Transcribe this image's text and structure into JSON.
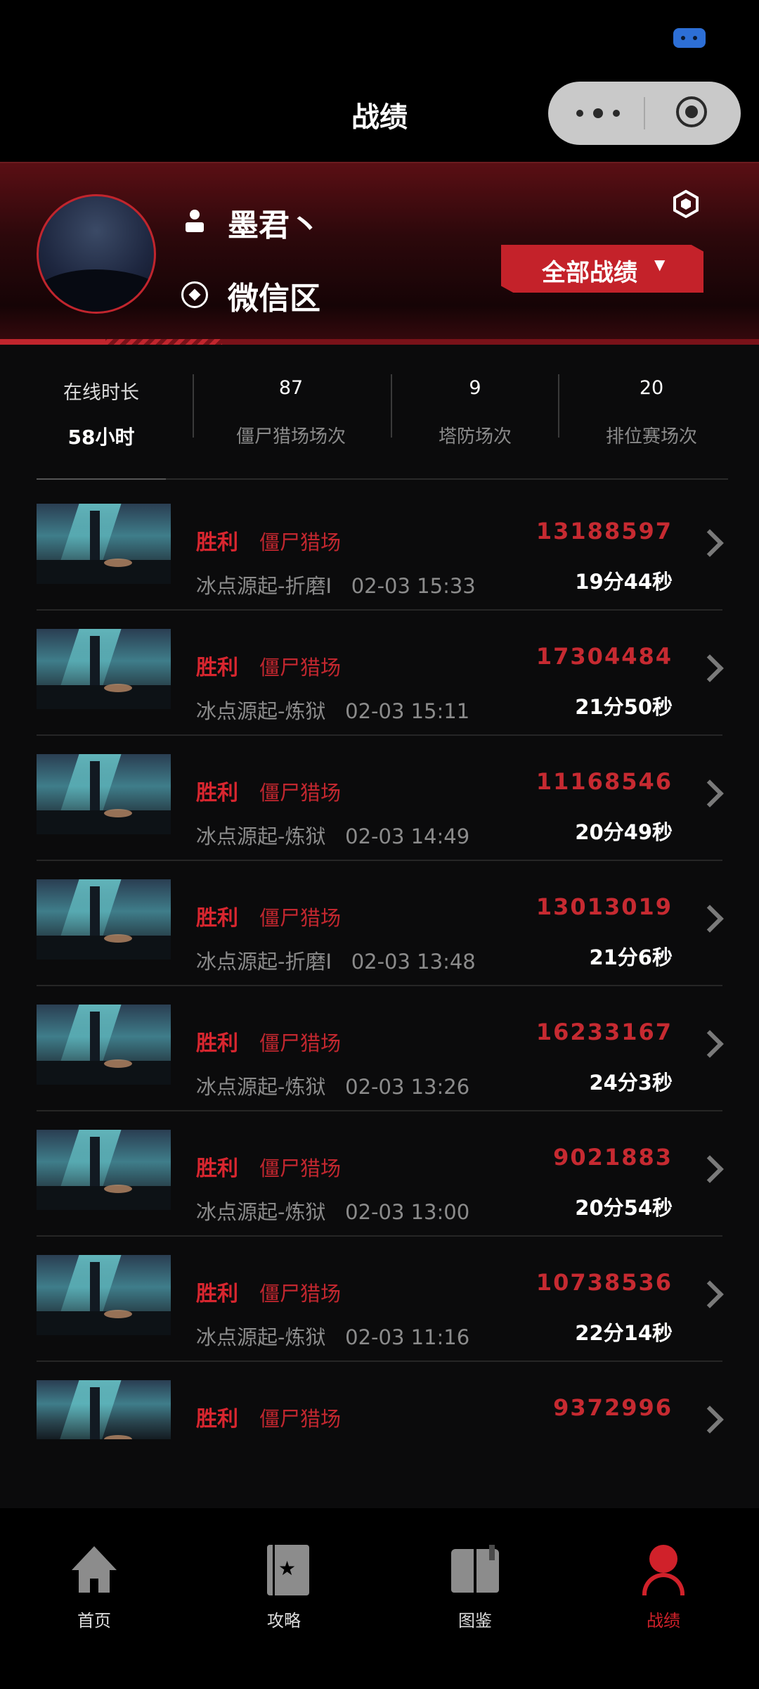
{
  "nav": {
    "title": "战绩"
  },
  "profile": {
    "username": "墨君丶",
    "zone": "微信区",
    "filter_label": "全部战绩",
    "filter_caret": "▼"
  },
  "stats": [
    {
      "top": "在线时长",
      "bottom": "58小时"
    },
    {
      "top": "87",
      "bottom": "僵尸猎场场次"
    },
    {
      "top": "9",
      "bottom": "塔防场次"
    },
    {
      "top": "20",
      "bottom": "排位赛场次"
    }
  ],
  "records": [
    {
      "result": "胜利",
      "mode": "僵尸猎场",
      "map": "冰点源起-折磨I",
      "time": "02-03 15:33",
      "score": "13188597",
      "duration": "19分44秒"
    },
    {
      "result": "胜利",
      "mode": "僵尸猎场",
      "map": "冰点源起-炼狱",
      "time": "02-03 15:11",
      "score": "17304484",
      "duration": "21分50秒"
    },
    {
      "result": "胜利",
      "mode": "僵尸猎场",
      "map": "冰点源起-炼狱",
      "time": "02-03 14:49",
      "score": "11168546",
      "duration": "20分49秒"
    },
    {
      "result": "胜利",
      "mode": "僵尸猎场",
      "map": "冰点源起-折磨I",
      "time": "02-03 13:48",
      "score": "13013019",
      "duration": "21分6秒"
    },
    {
      "result": "胜利",
      "mode": "僵尸猎场",
      "map": "冰点源起-炼狱",
      "time": "02-03 13:26",
      "score": "16233167",
      "duration": "24分3秒"
    },
    {
      "result": "胜利",
      "mode": "僵尸猎场",
      "map": "冰点源起-炼狱",
      "time": "02-03 13:00",
      "score": "9021883",
      "duration": "20分54秒"
    },
    {
      "result": "胜利",
      "mode": "僵尸猎场",
      "map": "冰点源起-炼狱",
      "time": "02-03 11:16",
      "score": "10738536",
      "duration": "22分14秒"
    },
    {
      "result": "胜利",
      "mode": "僵尸猎场",
      "map": "",
      "time": "",
      "score": "9372996",
      "duration": ""
    }
  ],
  "tabs": [
    {
      "label": "首页",
      "icon": "home-icon",
      "active": false
    },
    {
      "label": "攻略",
      "icon": "guide-book-icon",
      "active": false
    },
    {
      "label": "图鉴",
      "icon": "atlas-book-icon",
      "active": false
    },
    {
      "label": "战绩",
      "icon": "person-icon",
      "active": true
    }
  ],
  "colors": {
    "accent": "#c4222a",
    "background": "#0b0b0c"
  }
}
